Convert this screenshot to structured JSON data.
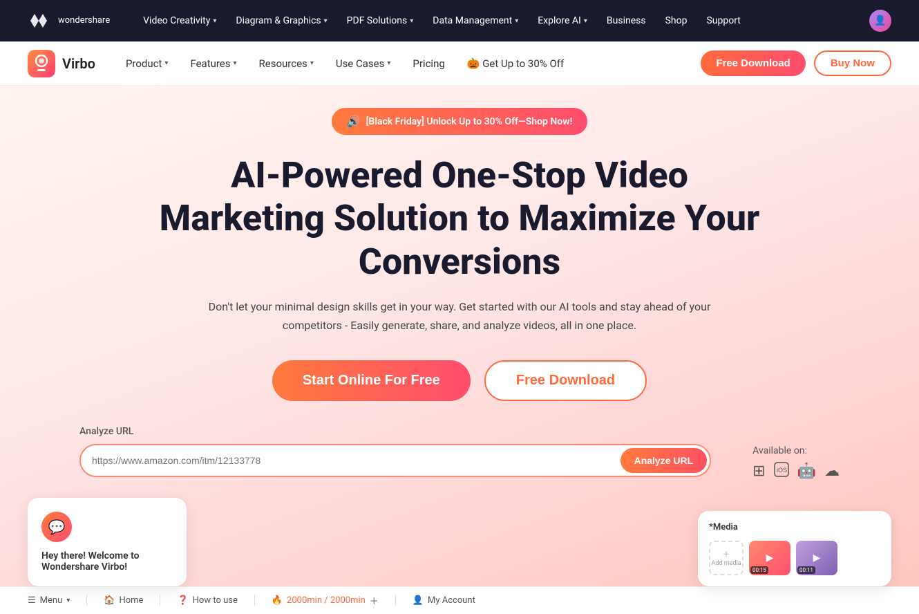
{
  "topNav": {
    "logoText": "wondershare",
    "items": [
      {
        "label": "Video Creativity",
        "hasDropdown": true
      },
      {
        "label": "Diagram & Graphics",
        "hasDropdown": true
      },
      {
        "label": "PDF Solutions",
        "hasDropdown": true
      },
      {
        "label": "Data Management",
        "hasDropdown": true
      },
      {
        "label": "Explore AI",
        "hasDropdown": true
      },
      {
        "label": "Business",
        "hasDropdown": false
      },
      {
        "label": "Shop",
        "hasDropdown": false
      },
      {
        "label": "Support",
        "hasDropdown": false
      }
    ]
  },
  "productNav": {
    "brandName": "Virbo",
    "items": [
      {
        "label": "Product",
        "hasDropdown": true
      },
      {
        "label": "Features",
        "hasDropdown": true
      },
      {
        "label": "Resources",
        "hasDropdown": true
      },
      {
        "label": "Use Cases",
        "hasDropdown": true
      },
      {
        "label": "Pricing",
        "hasDropdown": false
      }
    ],
    "promoText": "🎃 Get Up to 30% Off",
    "freeDownloadLabel": "Free Download",
    "buyNowLabel": "Buy Now"
  },
  "hero": {
    "promoBannerText": "[Black Friday] Unlock Up to 30% Off—Shop Now!",
    "title": "AI-Powered One-Stop Video Marketing Solution to Maximize Your Conversions",
    "subtitle": "Don't let your minimal design skills get in your way. Get started with our AI tools and stay ahead of your competitors - Easily generate, share, and analyze videos, all in one place.",
    "startOnlineLabel": "Start Online For Free",
    "freeDownloadLabel": "Free Download",
    "analyzeLabel": "Analyze URL",
    "analyzePlaceholder": "https://www.amazon.com/itm/12133778",
    "analyzeButtonLabel": "Analyze URL",
    "availableLabel": "Available on:",
    "chatCardTitle": "Hey there! Welcome to Wondershare Virbo!",
    "mediaCardTitle": "*Media",
    "mediaAddLabel": "Add media"
  },
  "bottomToolbar": {
    "menuLabel": "Menu",
    "homeLabel": "Home",
    "howToUseLabel": "How to use",
    "timeLabel": "2000min / 2000min",
    "myAccountLabel": "My Account"
  }
}
